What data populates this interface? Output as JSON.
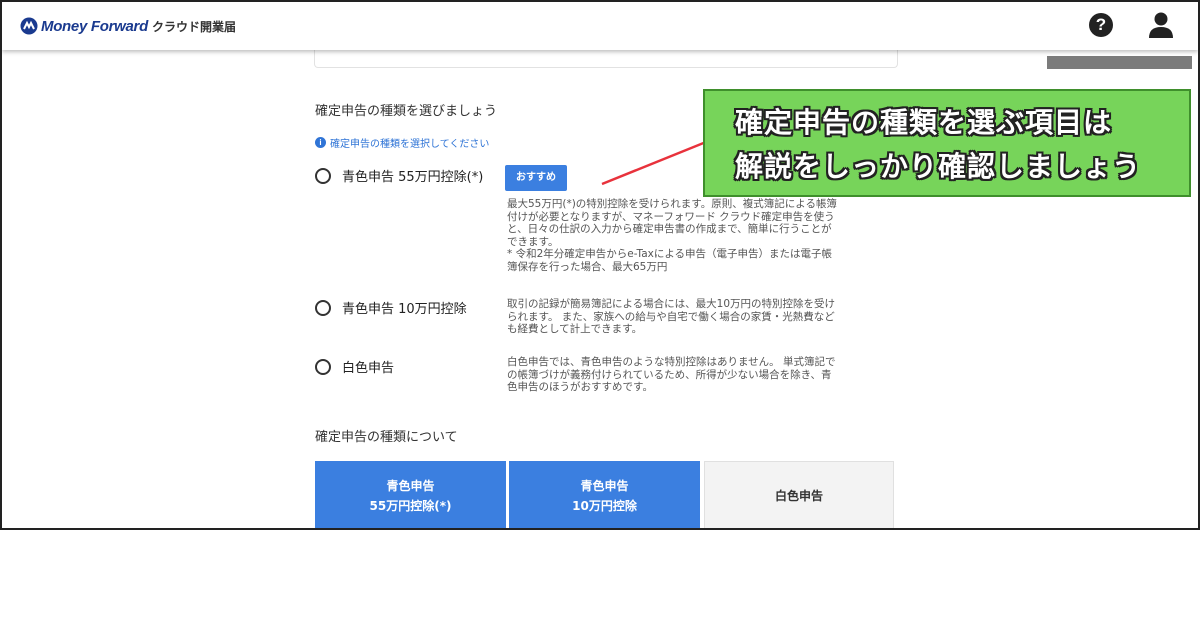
{
  "header": {
    "brand": "Money Forward",
    "product": "クラウド開業届",
    "help_icon": "question-circle-icon",
    "user_icon": "user-icon"
  },
  "main": {
    "section_title": "確定申告の種類を選びましょう",
    "hint": "確定申告の種類を選択してください",
    "options": [
      {
        "label": "青色申告 55万円控除(*)",
        "badge": "おすすめ",
        "description_lines": [
          "最大55万円(*)の特別控除を受けられます。原則、複式簿記による帳簿",
          "付けが必要となりますが、マネーフォワード クラウド確定申告を使う",
          "と、日々の仕訳の入力から確定申告書の作成まで、簡単に行うことが",
          "できます。",
          "* 令和2年分確定申告からe-Taxによる申告（電子申告）または電子帳",
          "簿保存を行った場合、最大65万円"
        ]
      },
      {
        "label": "青色申告 10万円控除",
        "description_lines": [
          "取引の記録が簡易簿記による場合には、最大10万円の特別控除を受け",
          "られます。 また、家族への給与や自宅で働く場合の家賃・光熱費など",
          "も経費として計上できます。"
        ]
      },
      {
        "label": "白色申告",
        "description_lines": [
          "白色申告では、青色申告のような特別控除はありません。 単式簿記で",
          "の帳簿づけが義務付けられているため、所得が少ない場合を除き、青",
          "色申告のほうがおすすめです。"
        ]
      }
    ],
    "about_title": "確定申告の種類について",
    "tabs": [
      {
        "line1": "青色申告",
        "line2": "55万円控除(*)"
      },
      {
        "line1": "青色申告",
        "line2": "10万円控除"
      },
      {
        "line1": "白色申告",
        "line2": ""
      }
    ]
  },
  "annotation": {
    "line1": "確定申告の種類を選ぶ項目は",
    "line2": "解説をしっかり確認しましょう",
    "color": "#77d45a",
    "arrow_color": "#e8323c"
  },
  "colors": {
    "accent_blue": "#3b7fe0",
    "brand_navy": "#1a3a8f",
    "hint_blue": "#2f74d6"
  }
}
